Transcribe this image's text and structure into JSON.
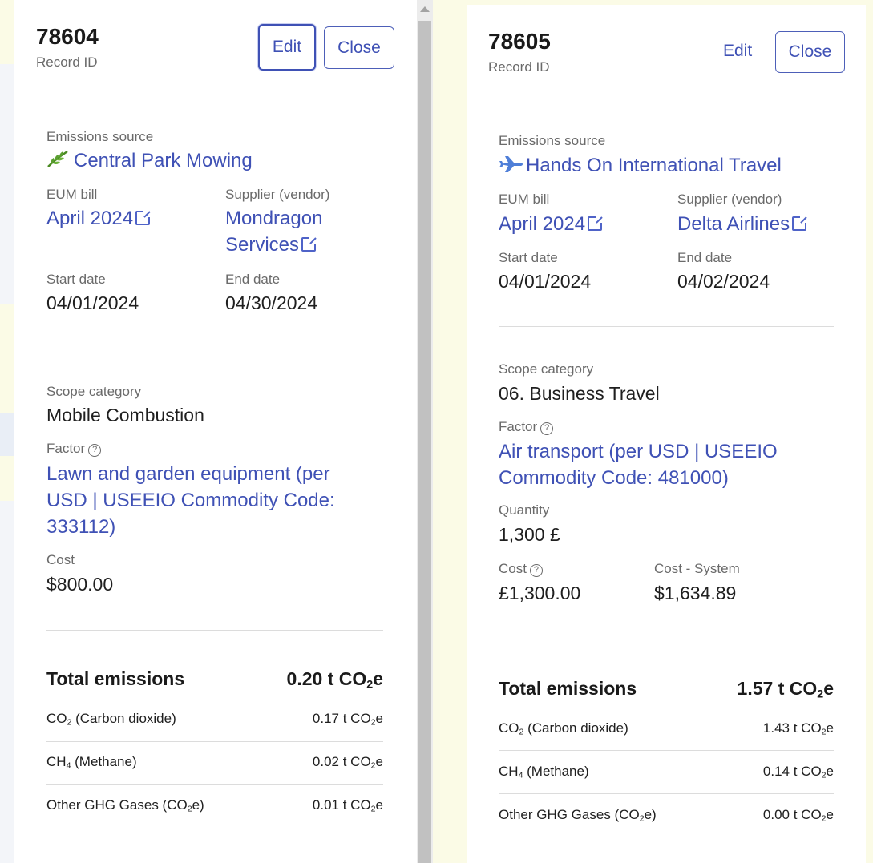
{
  "left": {
    "record_id": "78604",
    "record_id_label": "Record ID",
    "edit_label": "Edit",
    "close_label": "Close",
    "emissions_source_label": "Emissions source",
    "emissions_source": "Central Park Mowing",
    "emissions_source_icon": "leaf-icon",
    "eum_bill_label": "EUM bill",
    "eum_bill": "April 2024",
    "supplier_label": "Supplier (vendor)",
    "supplier_line1": "Mondragon",
    "supplier_line2": "Services",
    "start_date_label": "Start date",
    "start_date": "04/01/2024",
    "end_date_label": "End date",
    "end_date": "04/30/2024",
    "scope_category_label": "Scope category",
    "scope_category": "Mobile Combustion",
    "factor_label": "Factor",
    "factor_line1": "Lawn and garden equipment (per",
    "factor_line2": "USD | USEEIO Commodity Code:",
    "factor_line3": "333112)",
    "cost_label": "Cost",
    "cost": "$800.00",
    "total_label": "Total emissions",
    "total_value": "0.20 t CO",
    "gases": [
      {
        "name_pre": "CO",
        "name_sub": "2",
        "name_post": " (Carbon dioxide)",
        "value": "0.17 t CO"
      },
      {
        "name_pre": "CH",
        "name_sub": "4",
        "name_post": " (Methane)",
        "value": "0.02 t CO"
      },
      {
        "name_pre": "Other GHG Gases (CO",
        "name_sub": "2",
        "name_post": "e)",
        "value": "0.01 t CO"
      }
    ]
  },
  "right": {
    "record_id": "78605",
    "record_id_label": "Record ID",
    "edit_label": "Edit",
    "close_label": "Close",
    "emissions_source_label": "Emissions source",
    "emissions_source": "Hands On International Travel",
    "emissions_source_icon": "airplane-icon",
    "eum_bill_label": "EUM bill",
    "eum_bill": "April 2024",
    "supplier_label": "Supplier (vendor)",
    "supplier": "Delta Airlines",
    "start_date_label": "Start date",
    "start_date": "04/01/2024",
    "end_date_label": "End date",
    "end_date": "04/02/2024",
    "scope_category_label": "Scope category",
    "scope_category": "06. Business Travel",
    "factor_label": "Factor",
    "factor_line1": "Air transport (per USD | USEEIO",
    "factor_line2": "Commodity Code: 481000)",
    "quantity_label": "Quantity",
    "quantity": "1,300 £",
    "cost_label": "Cost",
    "cost": "£1,300.00",
    "cost_system_label": "Cost - System",
    "cost_system": "$1,634.89",
    "total_label": "Total emissions",
    "total_value": "1.57 t CO",
    "gases": [
      {
        "name_pre": "CO",
        "name_sub": "2",
        "name_post": " (Carbon dioxide)",
        "value": "1.43 t CO"
      },
      {
        "name_pre": "CH",
        "name_sub": "4",
        "name_post": " (Methane)",
        "value": "0.14 t CO"
      },
      {
        "name_pre": "Other GHG Gases (CO",
        "name_sub": "2",
        "name_post": "e)",
        "value": "0.00 t CO"
      }
    ]
  },
  "units": {
    "co2e_sub": "2",
    "co2e_tail": "e"
  },
  "colors": {
    "accent": "#3f51b5",
    "background": "#fbfbe6",
    "leaf": "#5a9e2f",
    "plane": "#4f7fd8"
  }
}
